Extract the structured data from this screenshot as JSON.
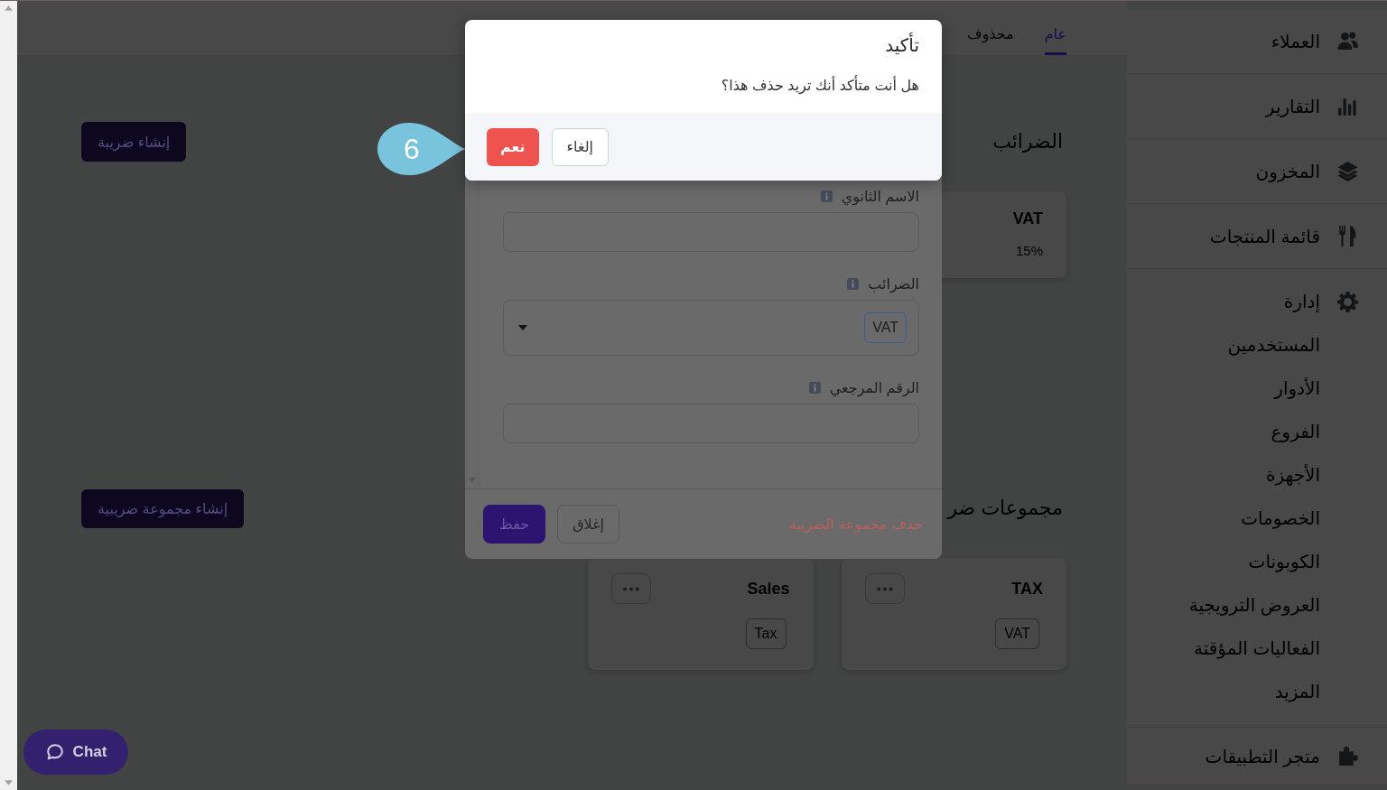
{
  "tabs": [
    {
      "label": "عام",
      "selected": true
    },
    {
      "label": "محذوف",
      "selected": false
    }
  ],
  "sidebar": {
    "items": [
      {
        "label": "العملاء"
      },
      {
        "label": "التقارير"
      },
      {
        "label": "المخزون"
      },
      {
        "label": "قائمة المنتجات"
      },
      {
        "label": "إدارة",
        "expanded": true,
        "children": [
          {
            "label": "المستخدمين"
          },
          {
            "label": "الأدوار"
          },
          {
            "label": "الفروع"
          },
          {
            "label": "الأجهزة"
          },
          {
            "label": "الخصومات"
          },
          {
            "label": "الكوبونات"
          },
          {
            "label": "العروض الترويجية"
          },
          {
            "label": "الفعاليات المؤقتة"
          },
          {
            "label": "المزيد"
          }
        ]
      },
      {
        "label": "متجر التطبيقات"
      }
    ]
  },
  "sections": [
    {
      "kind": "taxes",
      "title": "الضرائب",
      "create_button": "إنشاء ضريبة",
      "cards": [
        {
          "name": "VAT",
          "rate": "15%"
        }
      ]
    },
    {
      "kind": "groups",
      "title": "مجموعات ضر",
      "create_button": "إنشاء مجموعة ضريبية",
      "cards": [
        {
          "name": "TAX",
          "taxes": [
            "VAT"
          ]
        },
        {
          "name": "Sales",
          "taxes": [
            "Tax"
          ]
        }
      ]
    }
  ],
  "edit_dialog": {
    "fields": [
      {
        "kind": "text",
        "label": "الاسم الثانوي"
      },
      {
        "kind": "select",
        "label": "الضرائب",
        "chips": [
          "VAT"
        ]
      },
      {
        "kind": "text",
        "label": "الرقم المرجعي"
      }
    ],
    "delete_link": "حذف مجموعة الضريبة",
    "close_button": "إغلاق",
    "save_button": "حفظ"
  },
  "confirm_dialog": {
    "title": "تأكيد",
    "message": "هل أنت متأكد أنك تريد حذف هذا؟",
    "buttons": [
      {
        "kind": "secondary",
        "label": "إلغاء"
      },
      {
        "kind": "danger",
        "label": "نعم"
      }
    ]
  },
  "callout": {
    "label": "6"
  },
  "chat_button": {
    "label": "Chat"
  }
}
